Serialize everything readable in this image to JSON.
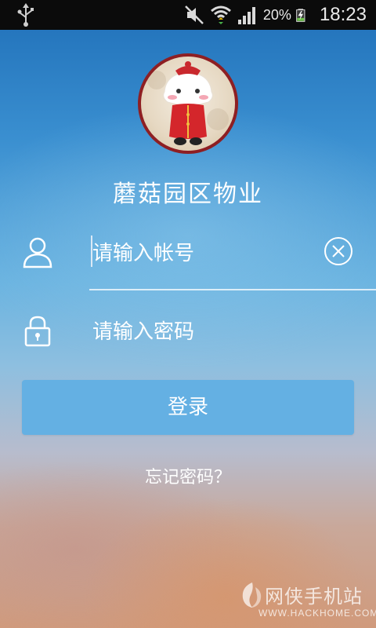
{
  "status_bar": {
    "battery_percent": "20%",
    "time": "18:23",
    "icons": [
      "usb-icon",
      "mute-icon",
      "wifi-icon",
      "signal-icon",
      "battery-charging-icon"
    ]
  },
  "app": {
    "name": "蘑菇园区物业",
    "avatar_icon": "mascot-avatar"
  },
  "login_form": {
    "username_placeholder": "请输入帐号",
    "password_placeholder": "请输入密码",
    "login_button": "登录",
    "forgot_password": "忘记密码？",
    "user_icon": "user-icon",
    "lock_icon": "lock-icon",
    "clear_icon": "clear-icon"
  },
  "watermark": {
    "title": "网侠手机站",
    "url": "WWW.HACKHOME.COM"
  },
  "colors": {
    "status_bar_bg": "#0b0b0b",
    "button_bg": "#64b0e3",
    "avatar_border": "#8e1f23"
  }
}
